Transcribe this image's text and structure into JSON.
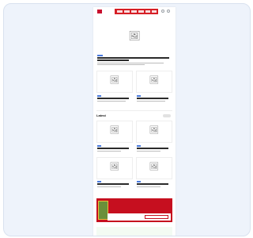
{
  "header": {
    "logo_text": "",
    "nav_items": [
      "",
      "",
      "",
      "",
      "",
      ""
    ],
    "icons": [
      "search-icon",
      "user-icon"
    ]
  },
  "lead_story": {
    "image_icon": "image-placeholder-icon",
    "headline": "",
    "meta": ""
  },
  "grid_top": [
    {
      "headline": "",
      "meta": ""
    },
    {
      "headline": "",
      "meta": ""
    }
  ],
  "latest": {
    "title": "Latest",
    "more_label": "",
    "cards": [
      {
        "headline": ""
      },
      {
        "headline": ""
      },
      {
        "headline": ""
      },
      {
        "headline": ""
      }
    ]
  },
  "promo": {
    "title": "",
    "subtitle": "",
    "brand": "",
    "cta": ""
  },
  "newsletter": {
    "title": "",
    "subtitle": ""
  },
  "colors": {
    "brand_red": "#d61f26",
    "tag_blue": "#4a7be0",
    "newsletter_green": "#57b35a"
  },
  "placeholder_glyph": "🖼"
}
